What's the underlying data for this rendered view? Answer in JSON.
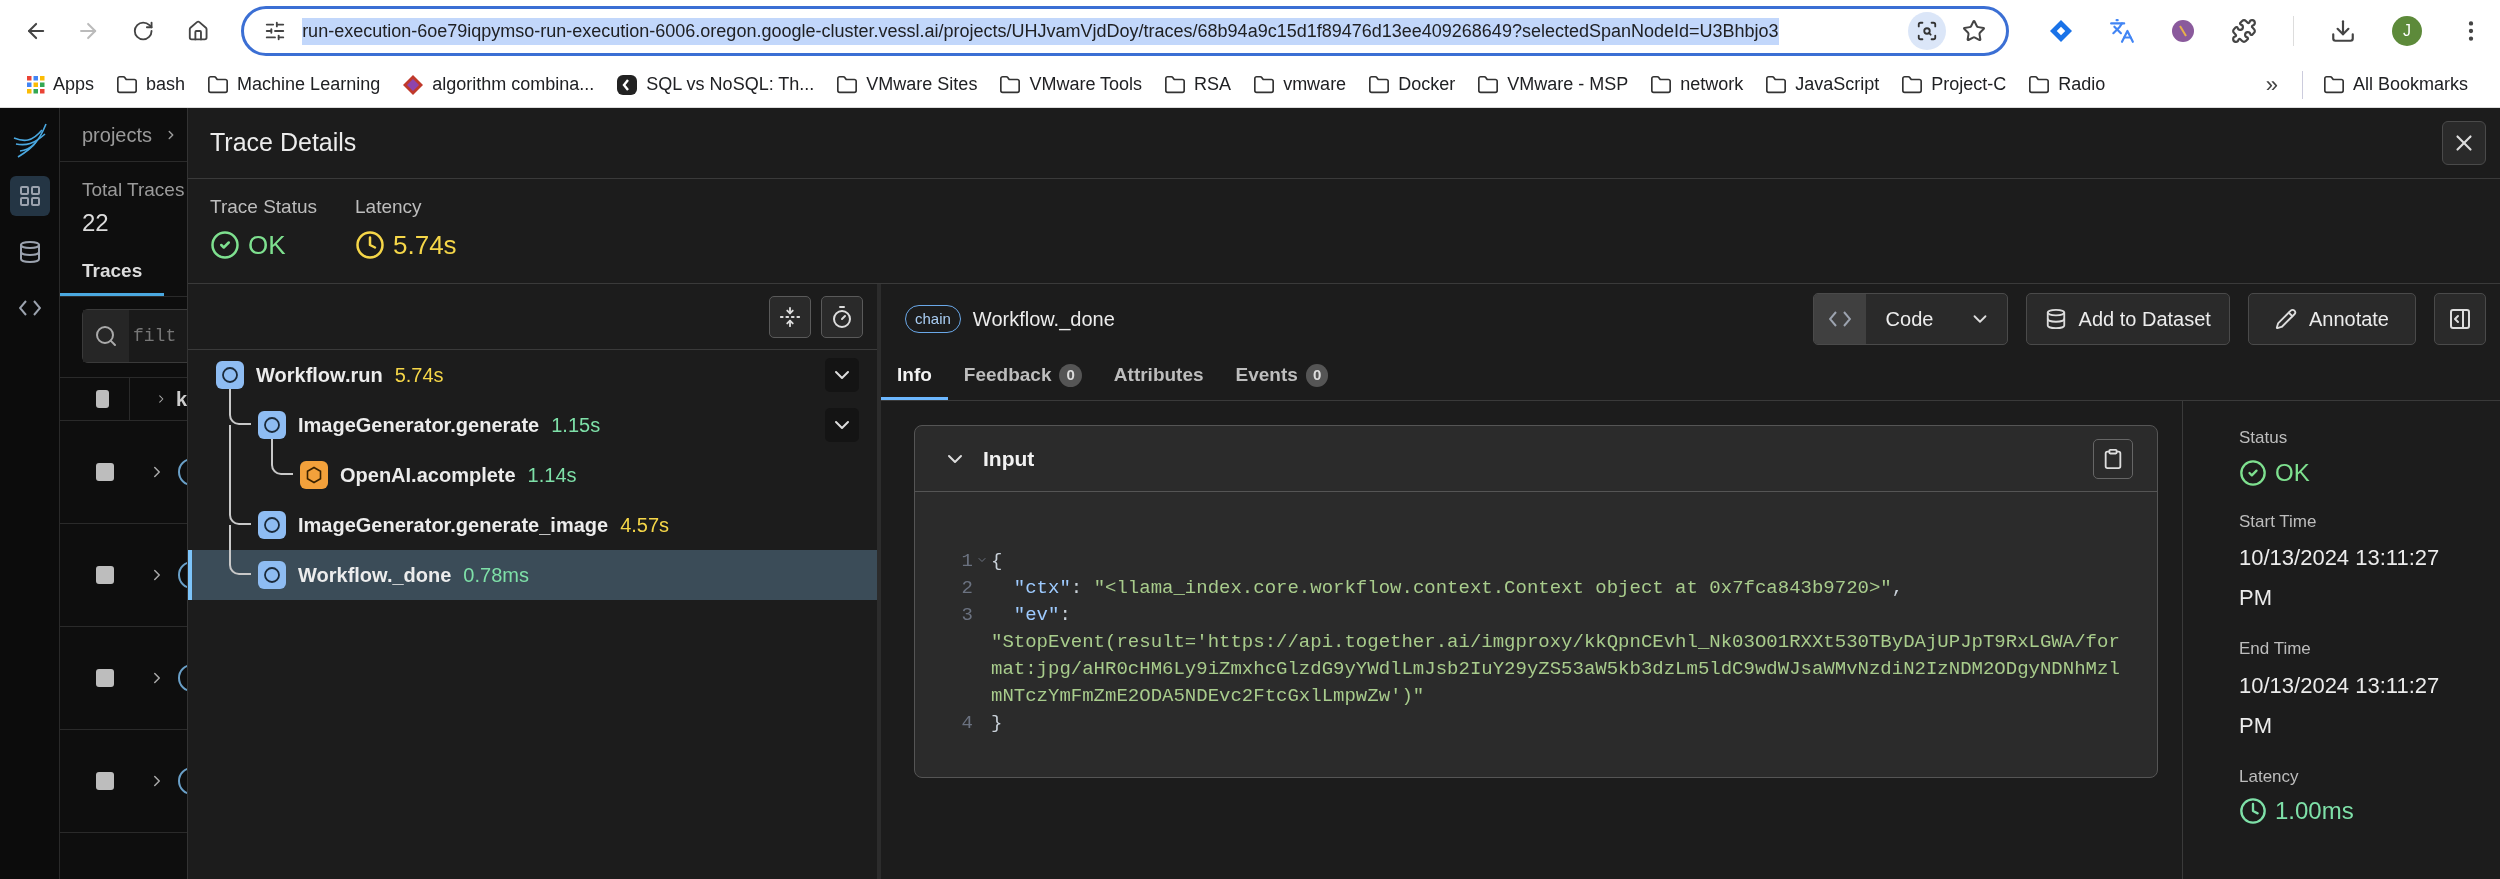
{
  "browser": {
    "url": "run-execution-6oe79iqpymso-run-execution-6006.oregon.google-cluster.vessl.ai/projects/UHJvamVjdDoy/traces/68b94a9c15d1f89476d13ee409268649?selectedSpanNodeId=U3Bhbjo3",
    "url_selected": true,
    "profile_initial": "J",
    "bookmarks": [
      {
        "label": "Apps",
        "kind": "apps"
      },
      {
        "label": "bash",
        "kind": "folder"
      },
      {
        "label": "Machine Learning",
        "kind": "folder"
      },
      {
        "label": "algorithm combina...",
        "kind": "gem"
      },
      {
        "label": "SQL vs NoSQL: Th...",
        "kind": "site"
      },
      {
        "label": "VMware Sites",
        "kind": "folder"
      },
      {
        "label": "VMware Tools",
        "kind": "folder"
      },
      {
        "label": "RSA",
        "kind": "folder"
      },
      {
        "label": "vmware",
        "kind": "folder"
      },
      {
        "label": "Docker",
        "kind": "folder"
      },
      {
        "label": "VMware - MSP",
        "kind": "folder"
      },
      {
        "label": "network",
        "kind": "folder"
      },
      {
        "label": "JavaScript",
        "kind": "folder"
      },
      {
        "label": "Project-C",
        "kind": "folder"
      },
      {
        "label": "Radio",
        "kind": "folder"
      }
    ],
    "overflow": "»",
    "all_bookmarks": "All Bookmarks"
  },
  "rail": [
    {
      "kind": "grid",
      "selected": true
    },
    {
      "kind": "database",
      "selected": false
    },
    {
      "kind": "code",
      "selected": false
    }
  ],
  "project": {
    "breadcrumb": "projects",
    "total_label": "Total Traces",
    "total": "22",
    "tab": "Traces",
    "search_placeholder": "filt",
    "header_checked": false,
    "column_1": "k",
    "rows": [
      {
        "checked": false
      },
      {
        "checked": false
      },
      {
        "checked": false
      },
      {
        "checked": false
      }
    ]
  },
  "trace": {
    "title": "Trace Details",
    "summary": [
      {
        "label": "Trace Status",
        "value": "OK",
        "kind": "status",
        "color": "#7ee08f"
      },
      {
        "label": "Latency",
        "value": "5.74s",
        "kind": "latency",
        "color": "#f5d648"
      }
    ]
  },
  "spans": [
    {
      "name": "Workflow.run",
      "duration": "5.74s",
      "color": "#f5d648",
      "kind": "chain",
      "expanded": true,
      "selected": false,
      "children": [
        {
          "name": "ImageGenerator.generate",
          "duration": "1.15s",
          "color": "#7ee0a8",
          "kind": "chain",
          "expanded": true,
          "selected": false,
          "children": [
            {
              "name": "OpenAI.acomplete",
              "duration": "1.14s",
              "color": "#7ee0a8",
              "kind": "llm",
              "selected": false
            }
          ]
        },
        {
          "name": "ImageGenerator.generate_image",
          "duration": "4.57s",
          "color": "#f5d648",
          "kind": "chain",
          "selected": false
        },
        {
          "name": "Workflow._done",
          "duration": "0.78ms",
          "color": "#7ee0a8",
          "kind": "chain",
          "selected": true
        }
      ]
    }
  ],
  "detail": {
    "badge": "chain",
    "title": "Workflow._done",
    "view": "Code",
    "buttons": [
      {
        "label": "Add to Dataset",
        "kind": "dataset"
      },
      {
        "label": "Annotate",
        "kind": "annotate"
      }
    ],
    "tabs": [
      {
        "label": "Info",
        "selected": true
      },
      {
        "label": "Feedback",
        "count": "0",
        "selected": false
      },
      {
        "label": "Attributes",
        "selected": false
      },
      {
        "label": "Events",
        "count": "0",
        "selected": false
      }
    ],
    "input": {
      "title": "Input",
      "expanded": true,
      "lines": [
        {
          "number": "1",
          "kind": "text",
          "text": "{",
          "foldable": true
        },
        {
          "number": "2",
          "kind": "pair",
          "key": "\"ctx\"",
          "punct": ":",
          "value": "\"<llama_index.core.workflow.context.Context object at 0x7fca843b9720>\"",
          "end": ","
        },
        {
          "number": "3",
          "kind": "pair",
          "key": "\"ev\"",
          "punct": ":"
        },
        {
          "kind": "wrapped",
          "value": "\"StopEvent(result='https://api.together.ai/imgproxy/kkQpnCEvhl_Nk03O01RXXt530TByDAjUPJpT9RxLGWA/format:jpg/aHR0cHM6Ly9iZmxhcGlzdG9yYWdlLmJsb2IuY29yZS53aW5kb3dzLm5ldC9wdWJsaWMvNzdiN2IzNDM2ODgyNDNhMzlmNTczYmFmZmE2ODA5NDEvc2FtcGxlLmpwZw')\""
        },
        {
          "number": "4",
          "kind": "text",
          "text": "}"
        }
      ]
    },
    "attributes": [
      {
        "label": "Status",
        "value": "OK",
        "kind": "status",
        "color": "#7ee08f"
      },
      {
        "label": "Start Time",
        "value": "10/13/2024 13:11:27 PM",
        "kind": "text"
      },
      {
        "label": "End Time",
        "value": "10/13/2024 13:11:27 PM",
        "kind": "text"
      },
      {
        "label": "Latency",
        "value": "1.00ms",
        "kind": "latency",
        "color": "#7ee0a8"
      }
    ]
  }
}
